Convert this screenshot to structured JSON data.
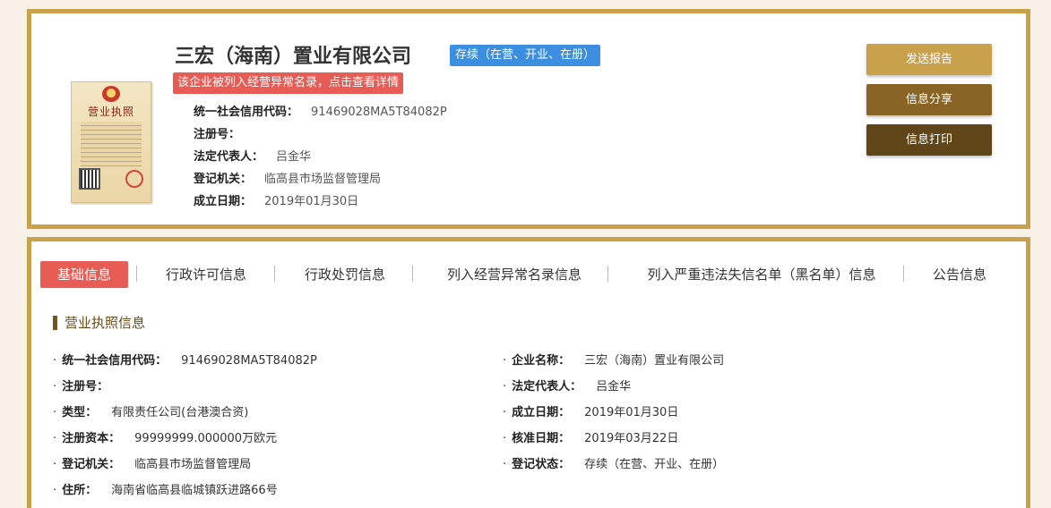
{
  "header": {
    "company_name": "三宏（海南）置业有限公司",
    "status": "存续（在营、开业、在册）",
    "warning": "该企业被列入经营异常名录，点击查看详情",
    "license_title": "营业执照",
    "rows": [
      {
        "label": "统一社会信用代码：",
        "value": "91469028MA5T84082P"
      },
      {
        "label": "注册号：",
        "value": ""
      },
      {
        "label": "法定代表人：",
        "value": "吕金华"
      },
      {
        "label": "登记机关：",
        "value": "临高县市场监督管理局"
      },
      {
        "label": "成立日期：",
        "value": "2019年01月30日"
      }
    ]
  },
  "actions": {
    "report": "发送报告",
    "share": "信息分享",
    "print": "信息打印"
  },
  "tabs": [
    {
      "label": "基础信息",
      "active": true
    },
    {
      "label": "行政许可信息"
    },
    {
      "label": "行政处罚信息"
    },
    {
      "label": "列入经营异常名录信息"
    },
    {
      "label": "列入严重违法失信名单（黑名单）信息"
    },
    {
      "label": "公告信息"
    }
  ],
  "section": {
    "title": "营业执照信息",
    "left": [
      {
        "label": "统一社会信用代码：",
        "value": "91469028MA5T84082P"
      },
      {
        "label": "注册号：",
        "value": ""
      },
      {
        "label": "类型：",
        "value": "有限责任公司(台港澳合资)"
      },
      {
        "label": "注册资本：",
        "value": "99999999.000000万欧元"
      },
      {
        "label": "登记机关：",
        "value": "临高县市场监督管理局"
      },
      {
        "label": "住所：",
        "value": "海南省临高县临城镇跃进路66号"
      }
    ],
    "right": [
      {
        "label": "企业名称：",
        "value": "三宏（海南）置业有限公司"
      },
      {
        "label": "法定代表人：",
        "value": "吕金华"
      },
      {
        "label": "成立日期：",
        "value": "2019年01月30日"
      },
      {
        "label": "核准日期：",
        "value": "2019年03月22日"
      },
      {
        "label": "登记状态：",
        "value": "存续（在营、开业、在册）"
      }
    ]
  },
  "colors": {
    "accent_gold": "#c9a14a",
    "active_tab": "#e85c56",
    "status_blue": "#3b8ee0"
  }
}
